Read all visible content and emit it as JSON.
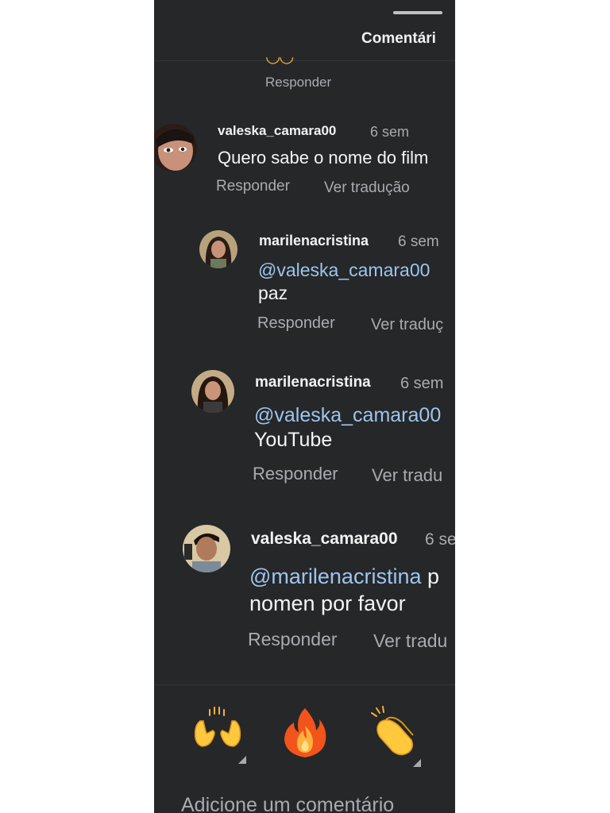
{
  "header": {
    "title": "Comentári"
  },
  "previous_comment": {
    "reply_label": "Responder"
  },
  "comments": [
    {
      "username": "valeska_camara00",
      "time": "6 sem",
      "text": "Quero sabe o nome do film",
      "reply_label": "Responder",
      "translate_label": "Ver tradução"
    },
    {
      "username": "marilenacristina",
      "time": "6 sem",
      "mention": "@valeska_camara00",
      "text": "paz",
      "reply_label": "Responder",
      "translate_label": "Ver traduç"
    },
    {
      "username": "marilenacristina",
      "time": "6 sem",
      "mention": "@valeska_camara00",
      "text": "YouTube",
      "reply_label": "Responder",
      "translate_label": "Ver tradu"
    },
    {
      "username": "valeska_camara00",
      "time": "6 se",
      "mention": "@marilenacristina",
      "mention_suffix": "p",
      "text": "nomen por favor",
      "reply_label": "Responder",
      "translate_label": "Ver tradu"
    }
  ],
  "quick_reactions": [
    "raising-hands-icon",
    "fire-icon",
    "clapping-hands-icon"
  ],
  "composer": {
    "placeholder": "Adicione um comentário"
  },
  "colors": {
    "background": "#262729",
    "mention": "#9cc5ee",
    "secondary_text": "#a9abb0"
  }
}
